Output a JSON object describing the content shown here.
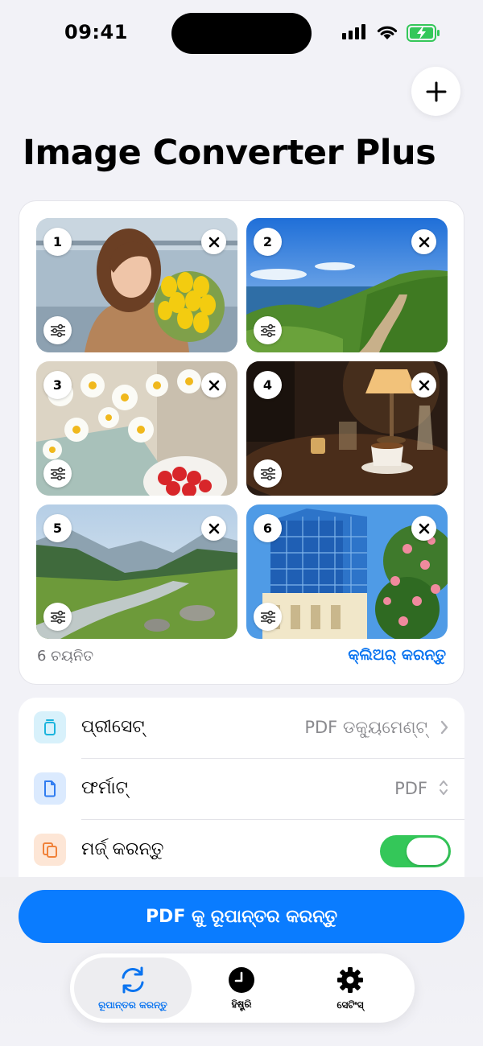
{
  "status": {
    "time": "09:41"
  },
  "header": {
    "title": "Image Converter Plus",
    "add_icon": "plus-icon"
  },
  "images": [
    {
      "number": "1"
    },
    {
      "number": "2"
    },
    {
      "number": "3"
    },
    {
      "number": "4"
    },
    {
      "number": "5"
    },
    {
      "number": "6"
    }
  ],
  "selection": {
    "count_text": "6 ଚୟନିତ",
    "clear_label": "କ୍ଲିଅର୍ କରନ୍ତୁ"
  },
  "settings": {
    "preset": {
      "label": "ପ୍ରୀସେଟ୍",
      "value": "PDF ଡକ୍ୟୁମେଣ୍ଟ୍",
      "icon": "document-stack-icon"
    },
    "format": {
      "label": "ଫର୍ମାଟ୍",
      "value": "PDF",
      "icon": "document-icon"
    },
    "merge": {
      "label": "ମର୍ଜ୍ କରନ୍ତୁ",
      "enabled": true,
      "icon": "merge-icon"
    }
  },
  "actions": {
    "convert_label": "PDF କୁ ରୂପାନ୍ତର କରନ୍ତୁ"
  },
  "tabs": [
    {
      "label": "ରୂପାନ୍ତର କରନ୍ତୁ",
      "icon": "convert-arrows-icon",
      "active": true
    },
    {
      "label": "ହିଷ୍ଟ୍ରି",
      "icon": "clock-icon",
      "active": false
    },
    {
      "label": "ସେଟିଂସ୍",
      "icon": "gear-icon",
      "active": false
    }
  ],
  "colors": {
    "accent": "#0a7cff",
    "toggle_on": "#34c759",
    "background": "#f2f2f7"
  }
}
